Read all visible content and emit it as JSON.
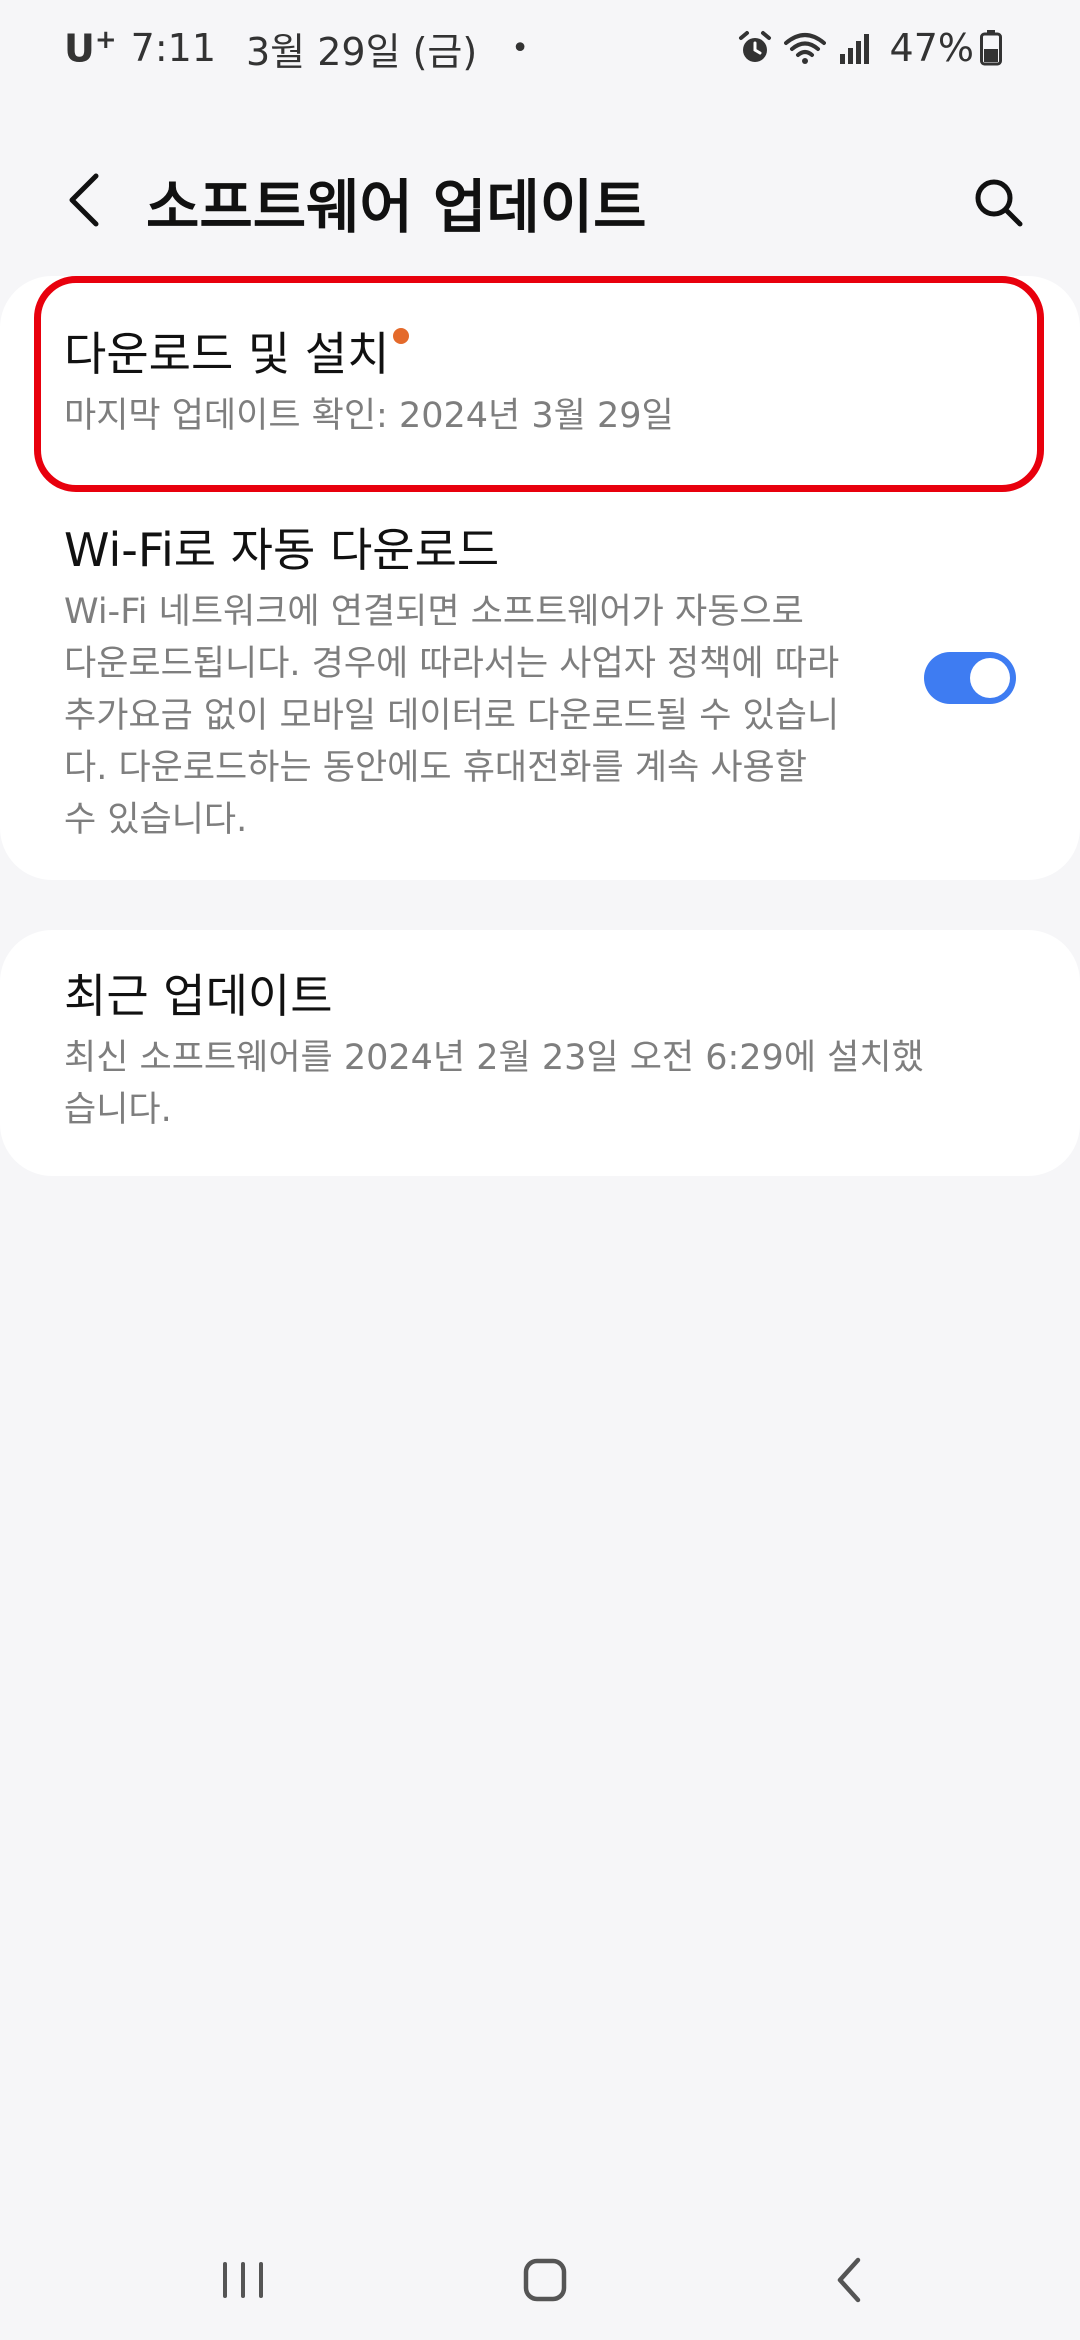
{
  "status_bar": {
    "carrier": "U",
    "carrier_plus": "+",
    "time": "7:11",
    "date": "3월 29일 (금)",
    "dot": "•",
    "battery": "47%",
    "icons": [
      "alarm-icon",
      "wifi-icon",
      "signal-icon",
      "battery-icon"
    ]
  },
  "header": {
    "title": "소프트웨어 업데이트",
    "back_icon": "chevron-left-icon",
    "search_icon": "search-icon"
  },
  "download_install": {
    "title": "다운로드 및 설치",
    "subtitle": "마지막 업데이트 확인: 2024년 3월 29일",
    "badge_color": "#e46a2b",
    "highlight_color": "#e8000d"
  },
  "wifi_auto": {
    "title": "Wi-Fi로 자동 다운로드",
    "description": "Wi-Fi 네트워크에 연결되면 소프트웨어가 자동으로 다운로드됩니다. 경우에 따라서는 사업자 정책에 따라 추가요금 없이 모바일 데이터로 다운로드될 수 있습니다. 다운로드하는 동안에도 휴대전화를 계속 사용할 수 있습니다.",
    "enabled": true,
    "toggle_color": "#3e7cf2"
  },
  "recent_update": {
    "title": "최근 업데이트",
    "description": "최신 소프트웨어를 2024년 2월 23일 오전 6:29에 설치했습니다."
  },
  "nav_bar": {
    "icons": [
      "recents-icon",
      "home-icon",
      "back-icon"
    ]
  }
}
